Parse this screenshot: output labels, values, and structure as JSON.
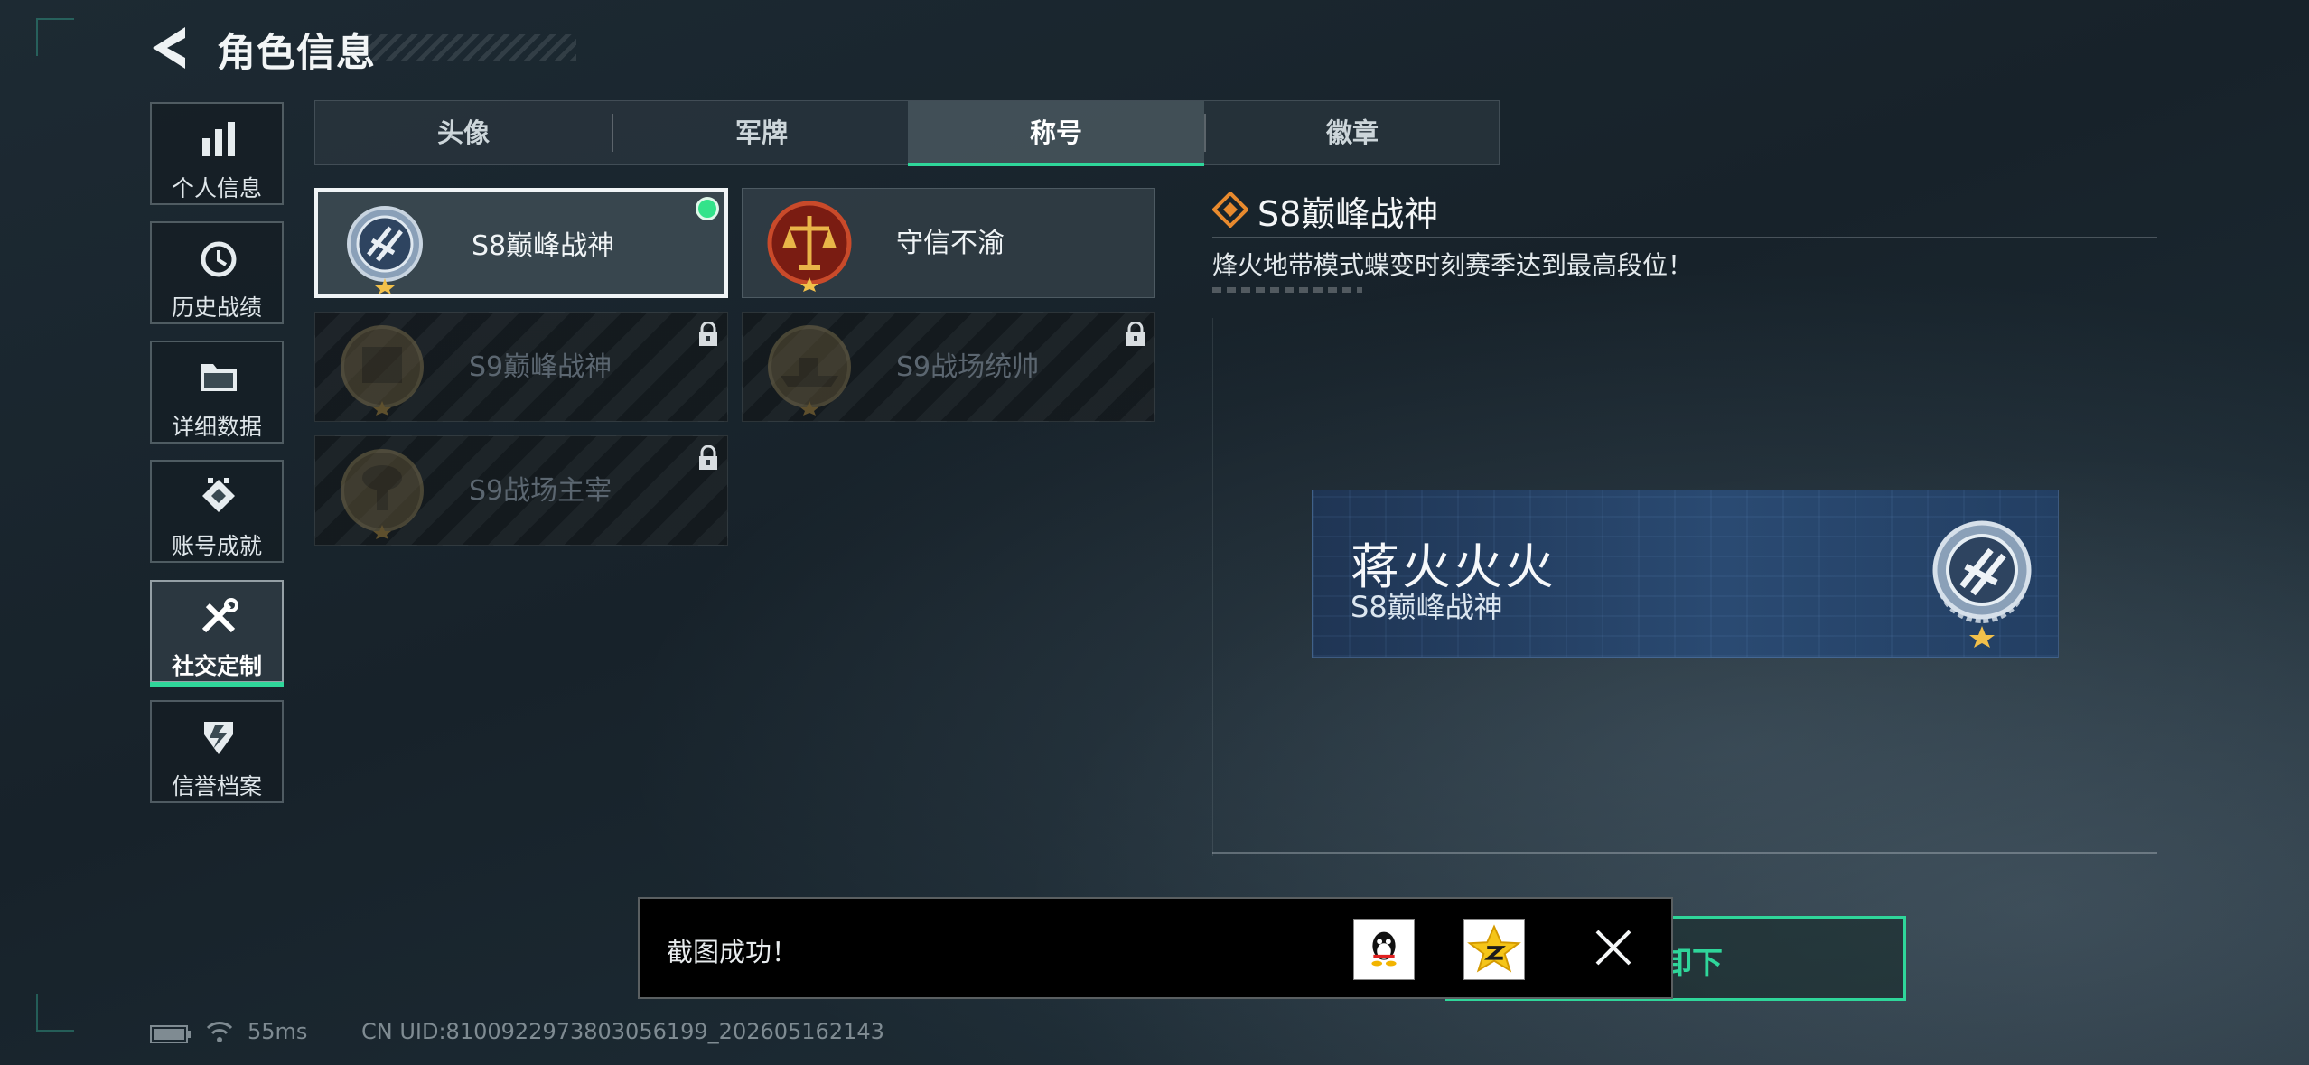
{
  "header": {
    "title": "角色信息",
    "back_icon": "back-arrow-icon"
  },
  "sidebar": {
    "items": [
      {
        "label": "个人信息",
        "icon": "bar-chart-icon",
        "active": false
      },
      {
        "label": "历史战绩",
        "icon": "history-clock-icon",
        "active": false
      },
      {
        "label": "详细数据",
        "icon": "folder-icon",
        "active": false
      },
      {
        "label": "账号成就",
        "icon": "achievement-icon",
        "active": false
      },
      {
        "label": "社交定制",
        "icon": "tools-icon",
        "active": true
      },
      {
        "label": "信誉档案",
        "icon": "credit-shield-icon",
        "active": false
      }
    ]
  },
  "tabs": [
    {
      "label": "头像",
      "active": false
    },
    {
      "label": "军牌",
      "active": false
    },
    {
      "label": "称号",
      "active": true
    },
    {
      "label": "徽章",
      "active": false
    }
  ],
  "titles": [
    {
      "name": "S8巅峰战神",
      "medal": "s8-peak-medal-icon",
      "state": "selected",
      "equipped": true
    },
    {
      "name": "守信不渝",
      "medal": "justice-scale-medal-icon",
      "state": "unlocked",
      "equipped": false
    },
    {
      "name": "S9巅峰战神",
      "medal": "s9-peak-medal-icon",
      "state": "locked",
      "equipped": false
    },
    {
      "name": "S9战场统帅",
      "medal": "warship-medal-icon",
      "state": "locked",
      "equipped": false
    },
    {
      "name": "S9战场主宰",
      "medal": "mushroom-cloud-medal-icon",
      "state": "locked",
      "equipped": false
    }
  ],
  "detail": {
    "title": "S8巅峰战神",
    "description": "烽火地带模式蝶变时刻赛季达到最高段位！"
  },
  "nameplate": {
    "player_name": "蒋火火火",
    "title": "S8巅峰战神"
  },
  "action_button": {
    "visible_label": "卸下"
  },
  "toast": {
    "message": "截图成功！",
    "share_targets": [
      "qq-icon",
      "qzone-icon"
    ],
    "close_icon": "close-icon"
  },
  "status": {
    "ping": "55ms",
    "uid": "CN UID:8100922973803056199_202605162143"
  },
  "colors": {
    "accent": "#2fd69a",
    "equipped_dot": "#32e38a",
    "nameplate_bg": "#2a4a72"
  }
}
